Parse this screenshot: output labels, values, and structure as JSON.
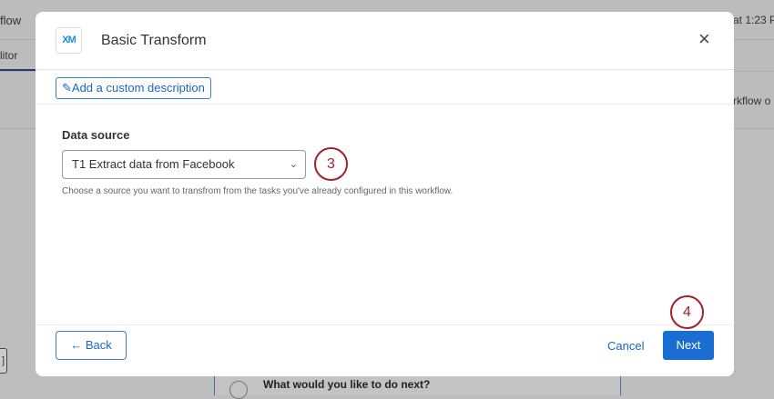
{
  "background": {
    "title_fragment": "flow",
    "tab_fragment": "litor",
    "timestamp_fragment": "at 1:23 P",
    "workflow_fragment": "rkflow o",
    "next_prompt": "What would you like to do next?"
  },
  "modal": {
    "logo": "XM",
    "title": "Basic Transform",
    "close": "×",
    "description_button": "Add a custom description",
    "data_source": {
      "label": "Data source",
      "value": "T1 Extract data from Facebook",
      "help": "Choose a source you want to transfrom from the tasks you've already configured in this workflow."
    },
    "footer": {
      "back": "Back",
      "cancel": "Cancel",
      "next": "Next"
    }
  },
  "annotations": [
    "3",
    "4"
  ],
  "colors": {
    "primary": "#1a6dd1",
    "annotation": "#a31f2c"
  }
}
